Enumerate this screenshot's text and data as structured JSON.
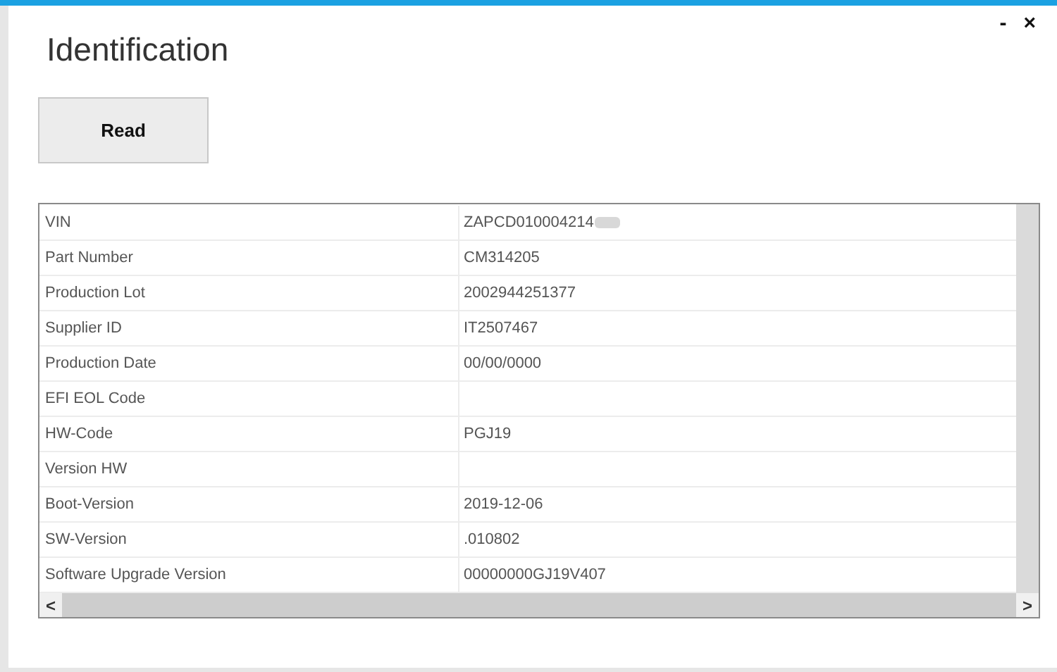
{
  "window": {
    "title": "Identification",
    "minimize": "-",
    "close": "×"
  },
  "read_button": "Read",
  "table": {
    "rows": [
      {
        "label": "VIN",
        "value": "ZAPCD010004214",
        "redacted": true
      },
      {
        "label": "Part Number",
        "value": "CM314205"
      },
      {
        "label": "Production Lot",
        "value": "2002944251377"
      },
      {
        "label": "Supplier ID",
        "value": "IT2507467"
      },
      {
        "label": "Production Date",
        "value": "00/00/0000"
      },
      {
        "label": "EFI EOL Code"
      },
      {
        "label": "HW-Code",
        "value": "PGJ19"
      },
      {
        "label": "Version HW"
      },
      {
        "label": "Boot-Version",
        "value": "2019-12-06"
      },
      {
        "label": "SW-Version",
        "value": ".010802"
      },
      {
        "label": "Software Upgrade Version",
        "value": "00000000GJ19V407"
      }
    ],
    "scroll_left": "<",
    "scroll_right": ">"
  }
}
